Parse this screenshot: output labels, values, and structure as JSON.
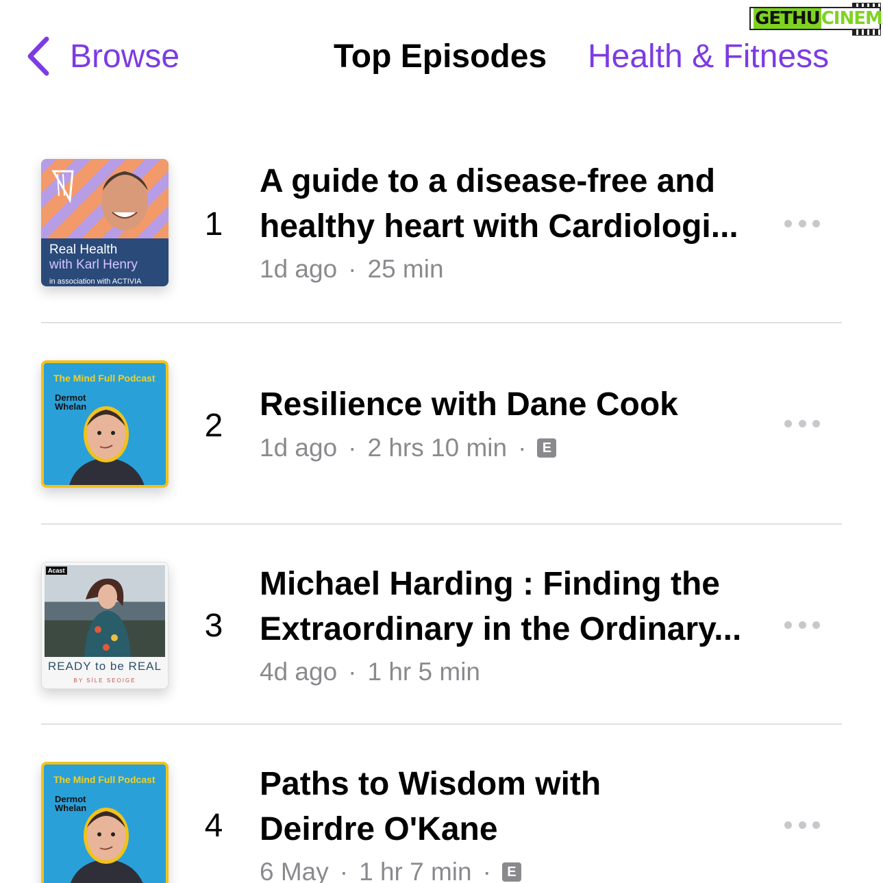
{
  "watermark": {
    "part1": "GETHU",
    "part2": "CINEMA"
  },
  "nav": {
    "back_label": "Browse",
    "title": "Top Episodes",
    "category": "Health & Fitness"
  },
  "episodes": [
    {
      "rank": "1",
      "title_line1": "A guide to a disease-free and",
      "title_line2": "healthy heart with Cardiologi...",
      "age": "1d ago",
      "duration": "25 min",
      "explicit": false,
      "art": {
        "line1": "Real Health",
        "line2": "with Karl Henry",
        "line3": "in association with ACTIVIA"
      }
    },
    {
      "rank": "2",
      "title_line1": "Resilience with Dane Cook",
      "age": "1d ago",
      "duration": "2 hrs 10 min",
      "explicit": true,
      "explicit_label": "E",
      "art": {
        "podcast": "The Mind Full Podcast",
        "host_line1": "Dermot",
        "host_line2": "Whelan"
      }
    },
    {
      "rank": "3",
      "title_line1": "Michael Harding : Finding the",
      "title_line2": "Extraordinary in the Ordinary...",
      "age": "4d ago",
      "duration": "1 hr 5 min",
      "explicit": false,
      "art": {
        "badge": "Acast",
        "name": "READY to be REAL",
        "by": "BY SÍLE SEOIGE"
      }
    },
    {
      "rank": "4",
      "title_line1": "Paths to Wisdom with",
      "title_line2": "Deirdre O'Kane",
      "age": "6 May",
      "duration": "1 hr 7 min",
      "explicit": true,
      "explicit_label": "E",
      "art": {
        "podcast": "The Mind Full Podcast",
        "host_line1": "Dermot",
        "host_line2": "Whelan"
      }
    }
  ],
  "colors": {
    "accent": "#7c3be3",
    "secondary_text": "#8a8a8e",
    "divider": "#e0e0e3"
  },
  "icons": {
    "back": "chevron-left-icon",
    "more": "more-ellipsis-icon"
  }
}
